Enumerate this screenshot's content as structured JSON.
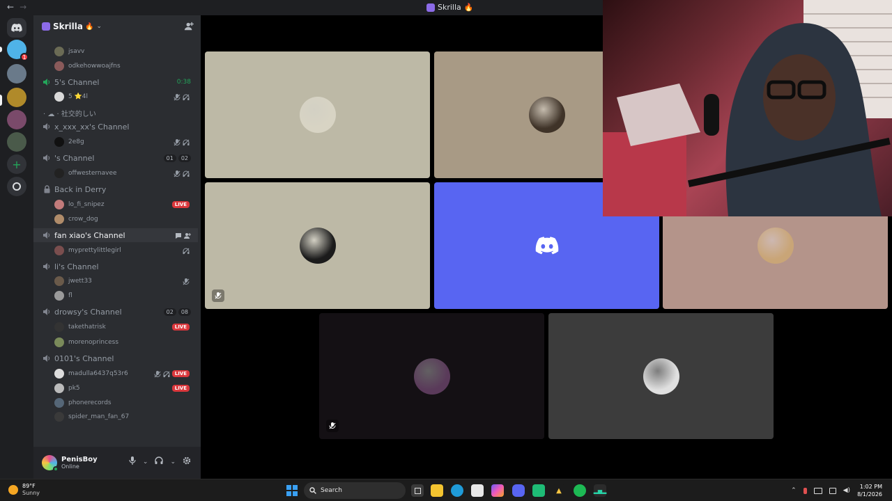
{
  "window": {
    "title": "Skrilla",
    "back_label": "←",
    "forward_label": "→"
  },
  "server": {
    "name": "Skrilla",
    "emoji": "🔥",
    "chevron": "⌄"
  },
  "sidebar": {
    "rows": [
      {
        "kind": "user",
        "name": "jsavv",
        "avatar_color": "#6b6b55"
      },
      {
        "kind": "user",
        "name": "odkehowwoajfns",
        "avatar_color": "#8a5a5a"
      },
      {
        "kind": "channel",
        "name": "5's Channel",
        "timer": "0:38",
        "icon": "speaker-icon-live"
      },
      {
        "kind": "user",
        "name": "5 ⭐4l",
        "avatar_color": "#d9d9d9",
        "icons": [
          "mic-muted-icon",
          "deafened-icon"
        ]
      },
      {
        "kind": "category",
        "name": "· ☁ · 社交的しい"
      },
      {
        "kind": "channel",
        "name": "x_xxx_xx's Channel",
        "icon": "speaker-icon"
      },
      {
        "kind": "user",
        "name": "2e8g",
        "avatar_color": "#111111",
        "icons": [
          "mic-muted-icon",
          "deafened-icon"
        ]
      },
      {
        "kind": "channel",
        "name": "'s Channel",
        "badges": [
          "01",
          "02"
        ],
        "icon": "speaker-icon"
      },
      {
        "kind": "user",
        "name": "offwesternavee",
        "avatar_color": "#222222",
        "icons": [
          "mic-muted-icon",
          "deafened-icon"
        ]
      },
      {
        "kind": "channel",
        "name": "Back in Derry",
        "icon": "lock-icon"
      },
      {
        "kind": "user",
        "name": "lo_fi_snipez",
        "avatar_color": "#c27b7b",
        "live": "LIVE"
      },
      {
        "kind": "user",
        "name": "crow_dog",
        "avatar_color": "#b08c6a"
      },
      {
        "kind": "channel",
        "name": "fan xiao's Channel",
        "icon": "speaker-icon",
        "highlight": true
      },
      {
        "kind": "user",
        "name": "myprettylittlegirl",
        "avatar_color": "#7a4e4e",
        "icons": [
          "deafened-icon"
        ]
      },
      {
        "kind": "channel",
        "name": "li's Channel",
        "icon": "speaker-icon"
      },
      {
        "kind": "user",
        "name": "jwett33",
        "avatar_color": "#6a5a4a",
        "icons": [
          "mic-muted-icon"
        ]
      },
      {
        "kind": "user",
        "name": "fl",
        "avatar_color": "#9a9a9a"
      },
      {
        "kind": "channel",
        "name": "drowsy's Channel",
        "badges": [
          "02",
          "08"
        ],
        "icon": "speaker-icon"
      },
      {
        "kind": "user",
        "name": "takethatrisk",
        "avatar_color": "#333333",
        "live": "LIVE"
      },
      {
        "kind": "user",
        "name": "morenoprincess",
        "avatar_color": "#7a8a5a"
      },
      {
        "kind": "channel",
        "name": "0101's Channel",
        "icon": "speaker-icon"
      },
      {
        "kind": "user",
        "name": "madulla6437q53r6",
        "avatar_color": "#dddddd",
        "icons": [
          "mic-muted-icon",
          "deafened-icon"
        ],
        "live": "LIVE"
      },
      {
        "kind": "user",
        "name": "pk5",
        "avatar_color": "#bbbbbb",
        "live": "LIVE"
      },
      {
        "kind": "user",
        "name": "phonerecords",
        "avatar_color": "#556677"
      },
      {
        "kind": "user",
        "name": "spider_man_fan_67",
        "avatar_color": "#3a3a3a"
      }
    ]
  },
  "me": {
    "name": "PenisBoy",
    "status": "Online"
  },
  "tiles": [
    {
      "id": "tile-1",
      "bg": "#bdb9a6",
      "avatar_color": "#d8d4c4"
    },
    {
      "id": "tile-2",
      "bg": "#a89a85",
      "avatar_color": "#3f3328"
    },
    {
      "id": "tile-3",
      "bg": "#bdb9a6",
      "avatar_color": "#1b1b1b",
      "muted": true
    },
    {
      "id": "tile-4",
      "bg": "#5865f2",
      "discord": true
    },
    {
      "id": "tile-5",
      "bg": "#b4948a",
      "avatar_color": "#c9a577"
    },
    {
      "id": "tile-6",
      "bg": "#141014",
      "avatar_color": "#5a3a5a",
      "muted": true
    },
    {
      "id": "tile-7",
      "bg": "#3c3c3c",
      "avatar_color": "#e0e0e0"
    }
  ],
  "taskbar": {
    "weather_temp": "89°F",
    "weather_cond": "Sunny",
    "search_label": "Search",
    "time": "1:02 PM",
    "date": "8/1/2026"
  }
}
